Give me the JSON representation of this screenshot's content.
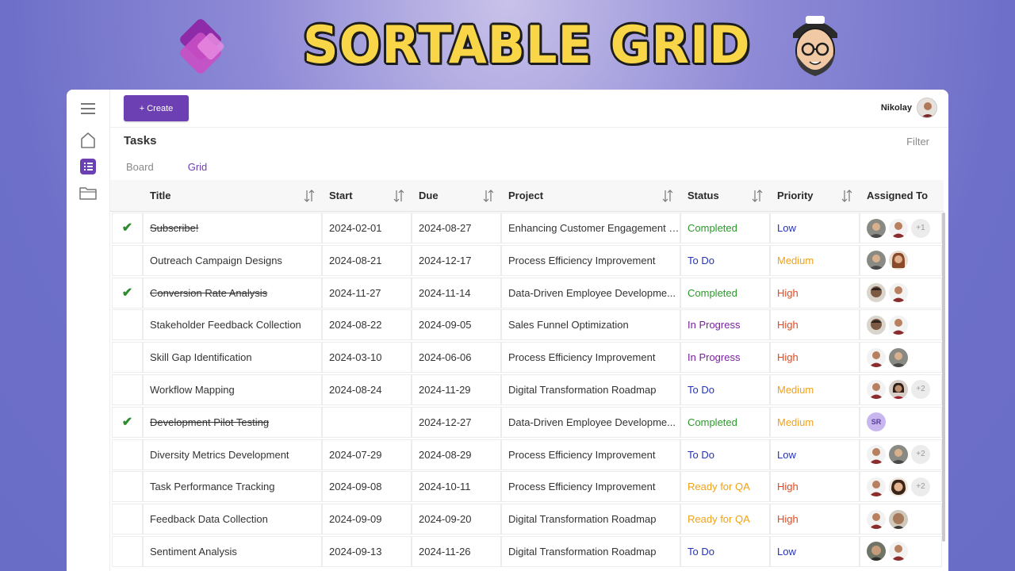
{
  "banner": {
    "title": "SORTABLE GRID"
  },
  "topbar": {
    "create_label": "+ Create",
    "user_name": "Nikolay"
  },
  "page": {
    "title": "Tasks",
    "filter_label": "Filter"
  },
  "tabs": [
    {
      "label": "Board",
      "active": false
    },
    {
      "label": "Grid",
      "active": true
    }
  ],
  "grid": {
    "columns": [
      "Title",
      "Start",
      "Due",
      "Project",
      "Status",
      "Priority",
      "Assigned To"
    ],
    "rows": [
      {
        "done": true,
        "title": "Subscribe!",
        "start": "2024-02-01",
        "due": "2024-08-27",
        "project": "Enhancing Customer Engagement S...",
        "status": "Completed",
        "priority": "Low",
        "avatars": [
          "m1",
          "m2"
        ],
        "more": "+1"
      },
      {
        "done": false,
        "title": "Outreach Campaign Designs",
        "start": "2024-08-21",
        "due": "2024-12-17",
        "project": "Process Efficiency Improvement",
        "status": "To Do",
        "priority": "Medium",
        "avatars": [
          "m1",
          "f1"
        ],
        "more": ""
      },
      {
        "done": true,
        "title": "Conversion Rate Analysis",
        "start": "2024-11-27",
        "due": "2024-11-14",
        "project": "Data-Driven Employee Developme...",
        "status": "Completed",
        "priority": "High",
        "avatars": [
          "m3",
          "m2"
        ],
        "more": ""
      },
      {
        "done": false,
        "title": "Stakeholder Feedback Collection",
        "start": "2024-08-22",
        "due": "2024-09-05",
        "project": "Sales Funnel Optimization",
        "status": "In Progress",
        "priority": "High",
        "avatars": [
          "m3",
          "m2"
        ],
        "more": ""
      },
      {
        "done": false,
        "title": "Skill Gap Identification",
        "start": "2024-03-10",
        "due": "2024-06-06",
        "project": "Process Efficiency Improvement",
        "status": "In Progress",
        "priority": "High",
        "avatars": [
          "m2",
          "m1"
        ],
        "more": ""
      },
      {
        "done": false,
        "title": "Workflow Mapping",
        "start": "2024-08-24",
        "due": "2024-11-29",
        "project": "Digital Transformation Roadmap",
        "status": "To Do",
        "priority": "Medium",
        "avatars": [
          "m2",
          "f2"
        ],
        "more": "+2"
      },
      {
        "done": true,
        "title": "Development Pilot Testing",
        "start": "",
        "due": "2024-12-27",
        "project": "Data-Driven Employee Developme...",
        "status": "Completed",
        "priority": "Medium",
        "avatars": [],
        "initials": "SR",
        "more": ""
      },
      {
        "done": false,
        "title": "Diversity Metrics Development",
        "start": "2024-07-29",
        "due": "2024-08-29",
        "project": "Process Efficiency Improvement",
        "status": "To Do",
        "priority": "Low",
        "avatars": [
          "m2",
          "m1"
        ],
        "more": "+2"
      },
      {
        "done": false,
        "title": "Task Performance Tracking",
        "start": "2024-09-08",
        "due": "2024-10-11",
        "project": "Process Efficiency Improvement",
        "status": "Ready for QA",
        "priority": "High",
        "avatars": [
          "m2",
          "f3"
        ],
        "more": "+2"
      },
      {
        "done": false,
        "title": "Feedback Data Collection",
        "start": "2024-09-09",
        "due": "2024-09-20",
        "project": "Digital Transformation Roadmap",
        "status": "Ready for QA",
        "priority": "High",
        "avatars": [
          "m2",
          "m4"
        ],
        "more": ""
      },
      {
        "done": false,
        "title": "Sentiment Analysis",
        "start": "2024-09-13",
        "due": "2024-11-26",
        "project": "Digital Transformation Roadmap",
        "status": "To Do",
        "priority": "Low",
        "avatars": [
          "m5",
          "m2"
        ],
        "more": ""
      }
    ]
  },
  "icons": [
    "menu-icon",
    "home-icon",
    "list-icon",
    "folder-icon",
    "sort-icon",
    "check-icon"
  ],
  "colors": {
    "accent": "#6c3fb2",
    "completed": "#2b9a2b",
    "todo": "#2433b8",
    "in_progress": "#7a1fa0",
    "ready_for_qa": "#f0a21a",
    "high": "#e0491d"
  }
}
